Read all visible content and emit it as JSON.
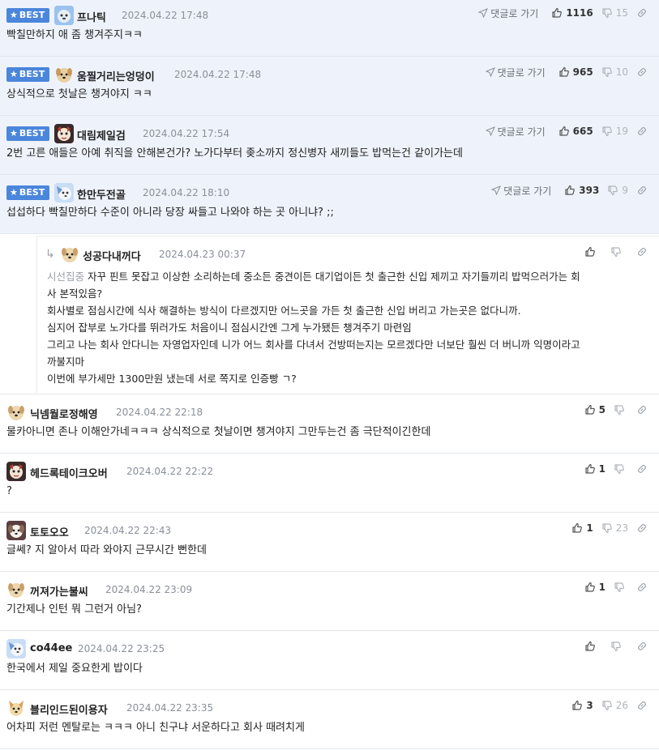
{
  "badge_label": "BEST",
  "reply_go_label": "댓글로 가기",
  "best_comments": [
    {
      "nick": "프나틱",
      "date": "2024.04.22 17:48",
      "text": "빡칠만하지 애 좀 챙겨주지ㅋㅋ",
      "up": "1116",
      "down": "15"
    },
    {
      "nick": "움찔거리는엉덩이",
      "date": "2024.04.22 17:48",
      "text": "상식적으로 첫날은 챙겨야지 ㅋㅋ",
      "up": "965",
      "down": "10"
    },
    {
      "nick": "대림제일검",
      "date": "2024.04.22 17:54",
      "text": "2번 고른 애들은 아예 취직을 안해본건가? 노가다부터 좆소까지 정신병자 새끼들도 밥먹는건 같이가는데",
      "up": "665",
      "down": "19"
    },
    {
      "nick": "한만두전골",
      "date": "2024.04.22 18:10",
      "text": "섭섭하다 빡칠만하다 수준이 아니라 당장 싸들고 나와야 하는 곳 아니냐? ;;",
      "up": "393",
      "down": "9"
    }
  ],
  "reply": {
    "nick": "성공다내꺼다",
    "date": "2024.04.23 00:37",
    "mention": "시선집중",
    "lines": [
      "자꾸 핀트 못잡고 이상한 소리하는데 중소든 중견이든 대기업이든 첫 출근한 신입 제끼고 자기들끼리 밥먹으러가는 회",
      "사 본적있음?",
      "회사별로 점심시간에 식사 해결하는 방식이 다르겠지만 어느곳을 가든 첫 출근한 신입 버리고 가는곳은 없다니까.",
      "심지어 잡부로 노가다를 뛰러가도 처음이니 점심시간엔 그게 누가됐든 챙겨주기 마련임",
      "그리고 나는 회사 안다니는 자영업자인데 니가 어느 회사를 다녀서 건방떠는지는 모르겠다만 너보단 훨씬 더 버니까 익명이라고",
      "까불지마",
      "이번에 부가세만 1300만원 냈는데 서로 쪽지로 인증빵 ㄱ?"
    ]
  },
  "comments": [
    {
      "nick": "닉넴월로정해영",
      "date": "2024.04.22 22:18",
      "text": "물카아니면 존나 이해안가네ㅋㅋㅋ 상식적으로 첫날이면 챙겨야지 그만두는건 좀 극단적이긴한데",
      "up": "5",
      "down": ""
    },
    {
      "nick": "헤드록테이크오버",
      "date": "2024.04.22 22:22",
      "text": "?",
      "up": "1",
      "down": ""
    },
    {
      "nick": "토토오오",
      "date": "2024.04.22 22:43",
      "text": "글쎄? 지 알아서 따라 와야지 근무시간 뻔한데",
      "up": "1",
      "down": "23"
    },
    {
      "nick": "꺼져가는불씨",
      "date": "2024.04.22 23:09",
      "text": "기간제나 인턴 뭐 그런거 아님?",
      "up": "1",
      "down": ""
    },
    {
      "nick": "co44ee",
      "date": "2024.04.22 23:25",
      "text": "한국에서 제일 중요한게 밥이다",
      "up": "",
      "down": ""
    },
    {
      "nick": "블리인드된이용자",
      "date": "2024.04.22 23:35",
      "text": "어차피 저런 멘탈로는 ㅋㅋㅋ 아니 친구냐 서운하다고 회사 때려치게",
      "up": "3",
      "down": "26"
    }
  ],
  "icons": {
    "star": "star-icon",
    "reply_arrow": "reply-arrow-icon",
    "send": "paper-plane-icon",
    "thumbs_up": "thumbs-up-icon",
    "thumbs_down": "thumbs-down-icon",
    "link": "link-icon"
  },
  "colors": {
    "badge": "#4a86db",
    "best_bg": "#eef3fb",
    "date": "#8a8f99"
  }
}
